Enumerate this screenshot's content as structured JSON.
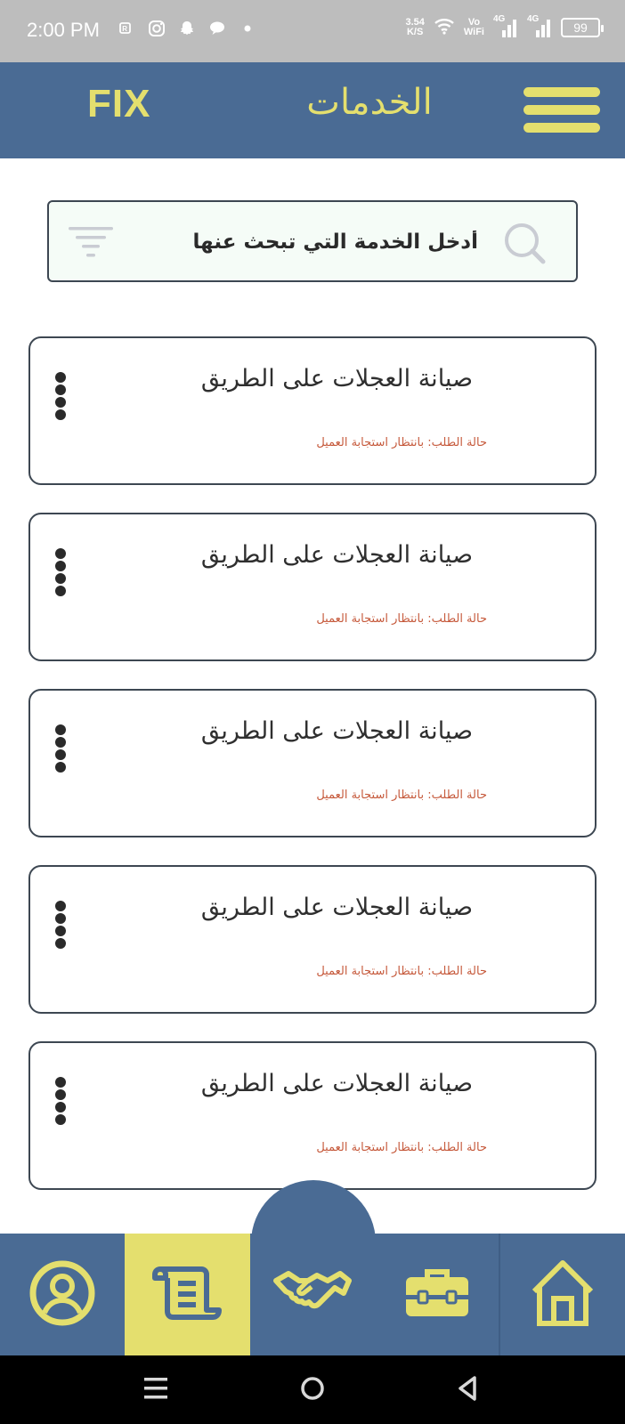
{
  "status_bar": {
    "time": "2:00 PM",
    "net_speed_value": "3.54",
    "net_speed_unit": "K/S",
    "vowifi_top": "Vo",
    "vowifi_bottom": "WiFi",
    "signal1_label": "4G",
    "signal2_label": "4G",
    "battery": "99",
    "left_icons": [
      "rcs-icon",
      "instagram-icon",
      "snapchat-icon",
      "chat-bubble-icon",
      "dot-icon"
    ]
  },
  "app_bar": {
    "logo": "FIX",
    "title": "الخدمات",
    "menu_icon": "hamburger-menu-icon"
  },
  "search": {
    "placeholder": "أدخل الخدمة التي تبحث عنها",
    "search_icon": "search-icon",
    "filter_icon": "filter-icon"
  },
  "services": [
    {
      "title": "صيانة العجلات على الطريق",
      "status": "حالة الطلب: بانتظار استجابة العميل"
    },
    {
      "title": "صيانة العجلات على الطريق",
      "status": "حالة الطلب: بانتظار استجابة العميل"
    },
    {
      "title": "صيانة العجلات على الطريق",
      "status": "حالة الطلب: بانتظار استجابة العميل"
    },
    {
      "title": "صيانة العجلات على الطريق",
      "status": "حالة الطلب: بانتظار استجابة العميل"
    },
    {
      "title": "صيانة العجلات على الطريق",
      "status": "حالة الطلب: بانتظار استجابة العميل"
    }
  ],
  "bottom_nav": {
    "items": [
      "profile-icon",
      "orders-scroll-icon",
      "handshake-icon",
      "toolbox-icon",
      "home-icon"
    ],
    "active": "orders-scroll-icon"
  },
  "colors": {
    "primary": "#4a6b94",
    "accent": "#e4df6e",
    "status_text": "#c65a3c",
    "card_border": "#3d4752"
  }
}
